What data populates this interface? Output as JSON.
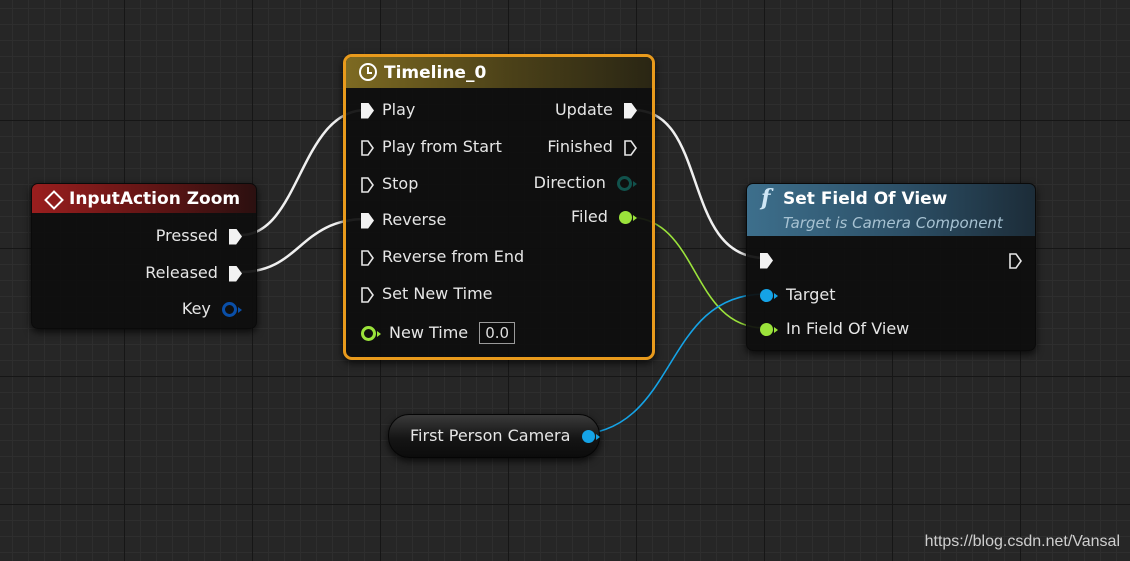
{
  "input_node": {
    "title": "InputAction Zoom",
    "pins": {
      "pressed": "Pressed",
      "released": "Released",
      "key": "Key"
    }
  },
  "timeline_node": {
    "title": "Timeline_0",
    "inputs": {
      "play": "Play",
      "play_from_start": "Play from Start",
      "stop": "Stop",
      "reverse": "Reverse",
      "reverse_from_end": "Reverse from End",
      "set_new_time": "Set New Time",
      "new_time": "New Time",
      "new_time_value": "0.0"
    },
    "outputs": {
      "update": "Update",
      "finished": "Finished",
      "direction": "Direction",
      "filed": "Filed"
    }
  },
  "fov_node": {
    "function_icon": "f",
    "title": "Set Field Of View",
    "subtitle": "Target is Camera Component",
    "pins": {
      "target": "Target",
      "in_fov": "In Field Of View"
    }
  },
  "camera_node": {
    "label": "First Person Camera"
  },
  "watermark": "https://blog.csdn.net/Vansal",
  "colors": {
    "input_header": "#8a1c1c",
    "timeline_header": "#6b5a1e",
    "timeline_border": "#e89a1c",
    "fov_header": "#3b6a86",
    "exec_wire": "#f0f0f0",
    "float_pin": "#9be33b",
    "object_pin": "#15a3e6",
    "struct_pin": "#0a4fa8",
    "direction_pin": "#11524c"
  },
  "icons": {
    "input_node": "diamond-event-icon",
    "timeline_node": "clock-icon",
    "fov_node": "function-icon"
  }
}
